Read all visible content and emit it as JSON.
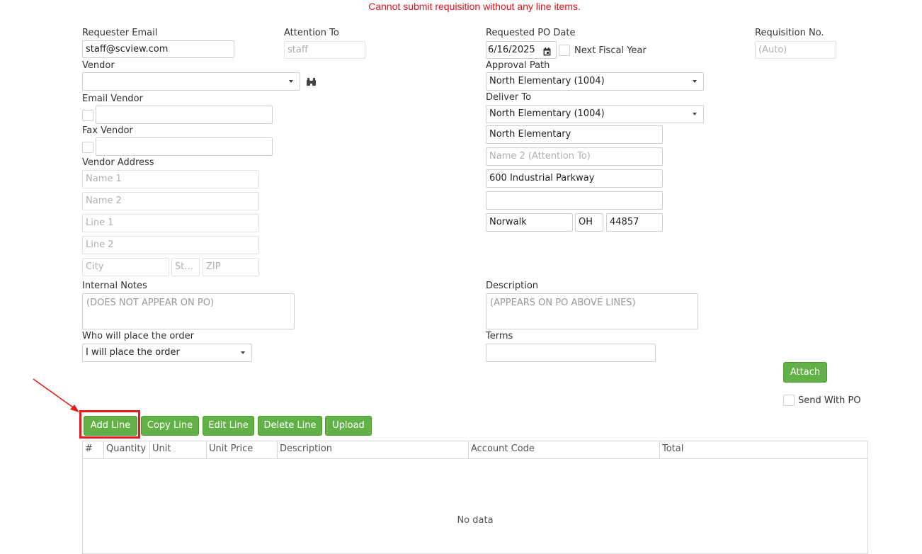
{
  "error_message": "Cannot submit requisition without any line items.",
  "labels": {
    "requester_email": "Requester Email",
    "attention_to": "Attention To",
    "requested_po_date": "Requested PO Date",
    "requisition_no": "Requisition No.",
    "vendor": "Vendor",
    "approval_path": "Approval Path",
    "email_vendor": "Email Vendor",
    "deliver_to": "Deliver To",
    "fax_vendor": "Fax Vendor",
    "vendor_address": "Vendor Address",
    "internal_notes": "Internal Notes",
    "description": "Description",
    "who_places": "Who will place the order",
    "terms": "Terms",
    "next_fiscal_year": "Next Fiscal Year",
    "send_with_po": "Send With PO"
  },
  "fields": {
    "requester_email": "staff@scview.com",
    "attention_to": "staff",
    "requested_po_date": "6/16/2025",
    "requisition_no": "(Auto)",
    "vendor": "",
    "approval_path": "North Elementary (1004)",
    "deliver_to": "North Elementary (1004)",
    "deliver_name1": "North Elementary",
    "deliver_name2": "Name 2 (Attention To)",
    "deliver_line1": "600 Industrial Parkway",
    "deliver_line2": "",
    "deliver_city": "Norwalk",
    "deliver_state": "OH",
    "deliver_zip": "44857",
    "vendor_name1": "Name 1",
    "vendor_name2": "Name 2",
    "vendor_line1": "Line 1",
    "vendor_line2": "Line 2",
    "vendor_city": "City",
    "vendor_state": "St...",
    "vendor_zip": "ZIP",
    "internal_notes": "(DOES NOT APPEAR ON PO)",
    "description": "(APPEARS ON PO ABOVE LINES)",
    "who_places": "I will place the order",
    "terms": ""
  },
  "buttons": {
    "attach": "Attach",
    "add_line": "Add Line",
    "copy_line": "Copy Line",
    "edit_line": "Edit Line",
    "delete_line": "Delete Line",
    "upload": "Upload"
  },
  "grid": {
    "columns": [
      "#",
      "Quantity",
      "Unit",
      "Unit Price",
      "Description",
      "Account Code",
      "Total"
    ],
    "empty_text": "No data"
  },
  "colors": {
    "button_green": "#62b146",
    "error_red": "#e3111b",
    "highlight_red": "#e41b1b"
  }
}
